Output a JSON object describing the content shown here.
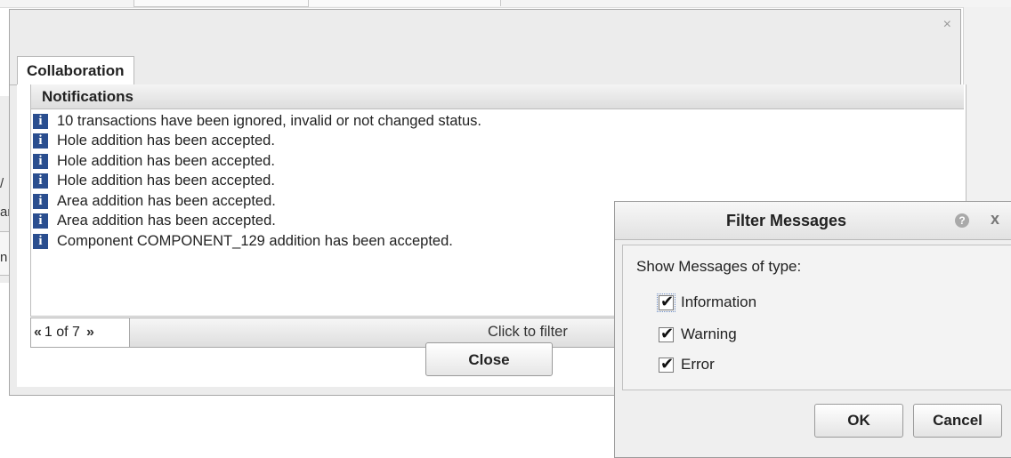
{
  "background": {
    "glyphs": [
      "/",
      "ar",
      "n"
    ]
  },
  "dialog": {
    "close_icon": "close-icon",
    "tab_label": "Collaboration",
    "notifications_header": "Notifications",
    "items": [
      {
        "icon": "i",
        "text": "10 transactions have been ignored, invalid or not changed status."
      },
      {
        "icon": "i",
        "text": "Hole addition has been accepted."
      },
      {
        "icon": "i",
        "text": "Hole addition has been accepted."
      },
      {
        "icon": "i",
        "text": "Hole addition has been accepted."
      },
      {
        "icon": "i",
        "text": "Area addition has been accepted."
      },
      {
        "icon": "i",
        "text": "Area addition has been accepted."
      },
      {
        "icon": "i",
        "text": "Component COMPONENT_129 addition has been accepted."
      }
    ],
    "pager": {
      "prev": "«",
      "page_text": "1 of 7",
      "next": "»",
      "filter_link": "Click to filter"
    },
    "close_button": "Close"
  },
  "filter_dialog": {
    "title": "Filter Messages",
    "help_icon": "?",
    "close_icon": "x",
    "show_label": "Show Messages of type:",
    "options": [
      {
        "label": "Information",
        "checked": true
      },
      {
        "label": "Warning",
        "checked": true
      },
      {
        "label": "Error",
        "checked": true
      }
    ],
    "ok_button": "OK",
    "cancel_button": "Cancel"
  },
  "colors": {
    "info_icon_bg": "#2a4e8f"
  }
}
